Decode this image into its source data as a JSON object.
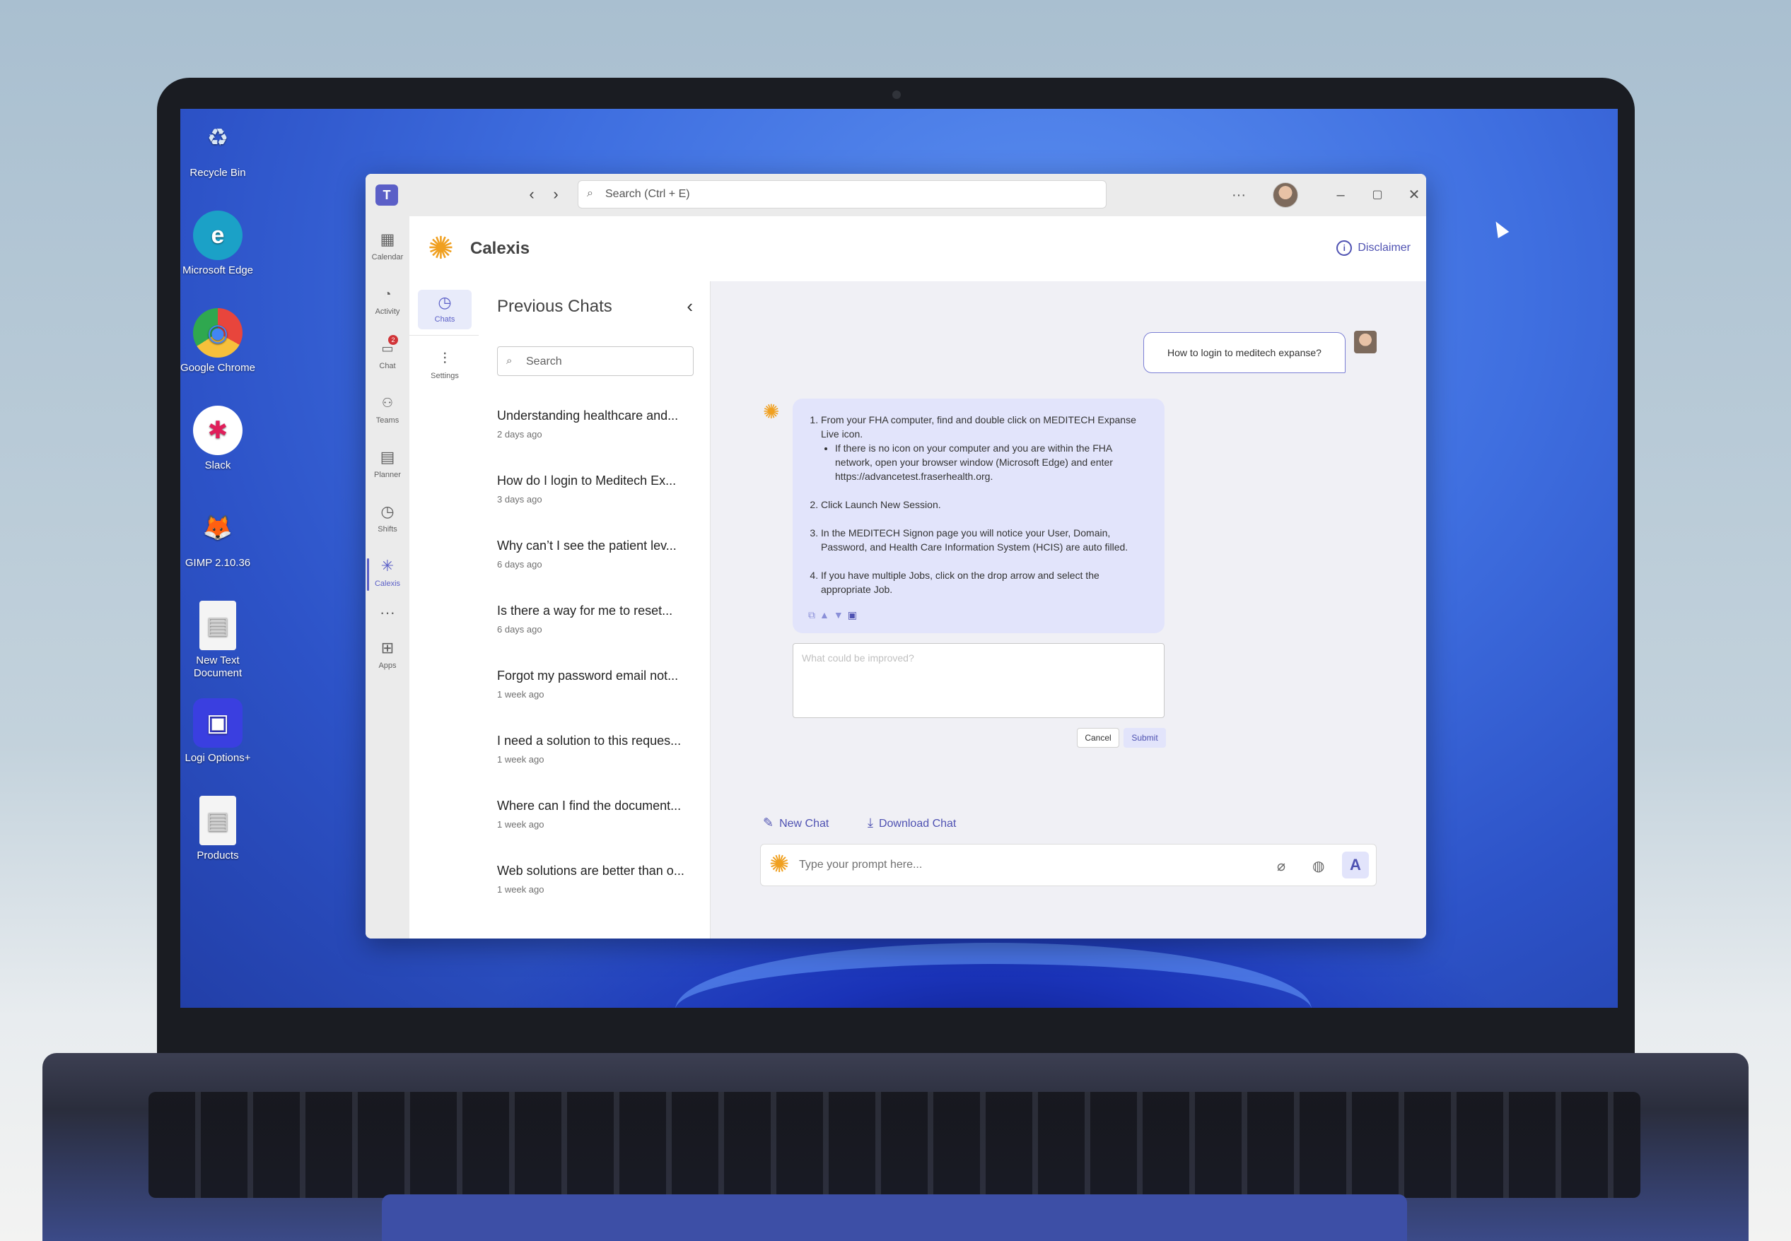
{
  "desktop": {
    "icons": [
      {
        "label": "Recycle Bin",
        "glyph": "♻",
        "color": "#d8e6f5"
      },
      {
        "label": "Microsoft Edge",
        "glyph": "e",
        "color": "#1ba1c7"
      },
      {
        "label": "Google Chrome",
        "glyph": "◉",
        "color": "#e8453c"
      },
      {
        "label": "Slack",
        "glyph": "✱",
        "color": "#ffffff"
      },
      {
        "label": "GIMP 2.10.36",
        "glyph": "🦊",
        "color": "#5a5a5a"
      },
      {
        "label": "New Text Document",
        "glyph": "▤",
        "color": "#f4f4f4"
      },
      {
        "label": "Logi Options+",
        "glyph": "▣",
        "color": "#3a3fe0"
      },
      {
        "label": "Products",
        "glyph": "▤",
        "color": "#f4f4f4"
      }
    ]
  },
  "titlebar": {
    "search_placeholder": "Search (Ctrl + E)",
    "more": "···"
  },
  "rail": {
    "items": [
      {
        "label": "Calendar",
        "icon": "calendar-icon",
        "glyph": "▦"
      },
      {
        "label": "Activity",
        "icon": "bell-icon",
        "glyph": "🔔"
      },
      {
        "label": "Chat",
        "icon": "chat-icon",
        "glyph": "💬",
        "badge": "2"
      },
      {
        "label": "Teams",
        "icon": "teams-icon",
        "glyph": "👥"
      },
      {
        "label": "Planner",
        "icon": "planner-icon",
        "glyph": "▤"
      },
      {
        "label": "Shifts",
        "icon": "clock-icon",
        "glyph": "◷"
      },
      {
        "label": "Calexis",
        "icon": "calexis-icon",
        "glyph": "✳"
      },
      {
        "label": "",
        "icon": "more-icon",
        "glyph": "···"
      },
      {
        "label": "Apps",
        "icon": "apps-icon",
        "glyph": "⊞"
      }
    ]
  },
  "app": {
    "title": "Calexis",
    "disclaimer": "Disclaimer"
  },
  "subrail": {
    "chats": "Chats",
    "settings": "Settings"
  },
  "previous_chats": {
    "title": "Previous Chats",
    "search_placeholder": "Search",
    "items": [
      {
        "title": "Understanding healthcare and...",
        "date": "2 days ago"
      },
      {
        "title": "How do I login to Meditech Ex...",
        "date": "3 days ago"
      },
      {
        "title": "Why can’t I see the patient lev...",
        "date": "6 days ago"
      },
      {
        "title": "Is there a way for me to reset...",
        "date": "6 days ago"
      },
      {
        "title": "Forgot my password email not...",
        "date": "1 week ago"
      },
      {
        "title": "I need a solution to this reques...",
        "date": "1 week ago"
      },
      {
        "title": "Where can I find the document...",
        "date": "1 week ago"
      },
      {
        "title": "Web solutions are better than o...",
        "date": "1 week ago"
      }
    ]
  },
  "conversation": {
    "user_message": "How to login to meditech expanse?",
    "bot_steps": {
      "s1": "From your FHA computer, find and double click on MEDITECH Expanse Live icon.",
      "s1_bullet": "If there is no icon on your computer and you are within the FHA network, open your browser window (Microsoft Edge) and enter https://advancetest.fraserhealth.org.",
      "s2": "Click Launch New Session.",
      "s3": "In the MEDITECH Signon page you will notice your User, Domain, Password, and Health Care Information System (HCIS) are auto filled.",
      "s4": "If you have multiple Jobs, click on the drop arrow and select the appropriate Job."
    },
    "feedback_placeholder": "What could be improved?",
    "cancel": "Cancel",
    "submit": "Submit"
  },
  "actions": {
    "new_chat": "New Chat",
    "download_chat": "Download Chat"
  },
  "prompt": {
    "placeholder": "Type your prompt here..."
  },
  "colors": {
    "accent": "#5b5fc7",
    "brand_orange": "#f0a020",
    "bubble": "#e2e4fb"
  }
}
